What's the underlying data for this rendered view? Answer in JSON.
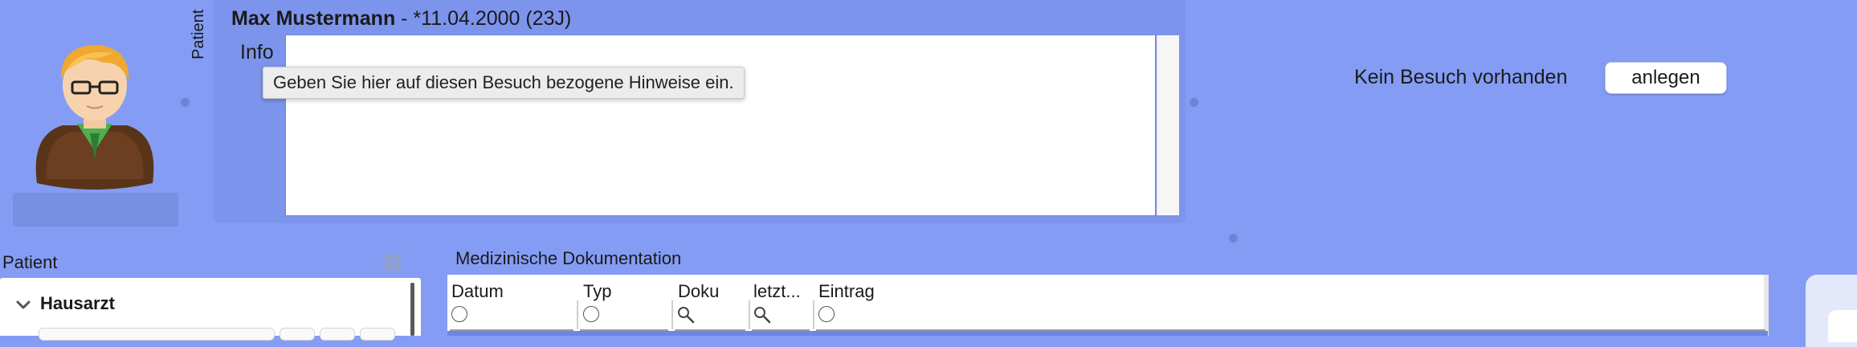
{
  "patient_panel": {
    "vertical_label": "Patient",
    "name": "Max Mustermann",
    "name_suffix": " - *11.04.2000 (23J)",
    "info_label": "Info",
    "info_value": "",
    "tooltip": "Geben Sie hier auf diesen Besuch bezogene Hinweise ein."
  },
  "visit": {
    "status_text": "Kein Besuch vorhanden",
    "create_button": "anlegen"
  },
  "left_section": {
    "title": "Patient",
    "settings_icon": "gear-icon",
    "group_label": "Hausarzt",
    "group_icon": "chevron-down-icon"
  },
  "documentation": {
    "title": "Medizinische Dokumentation",
    "columns": [
      {
        "label": "Datum",
        "filter": "radio"
      },
      {
        "label": "Typ",
        "filter": "radio"
      },
      {
        "label": "Doku",
        "filter": "search-icon"
      },
      {
        "label": "letzt...",
        "filter": "search-icon"
      },
      {
        "label": "Eintrag",
        "filter": "radio"
      }
    ]
  },
  "colors": {
    "background": "#849cf4",
    "panel": "#7d94ec",
    "selection": "#6c86e6"
  }
}
